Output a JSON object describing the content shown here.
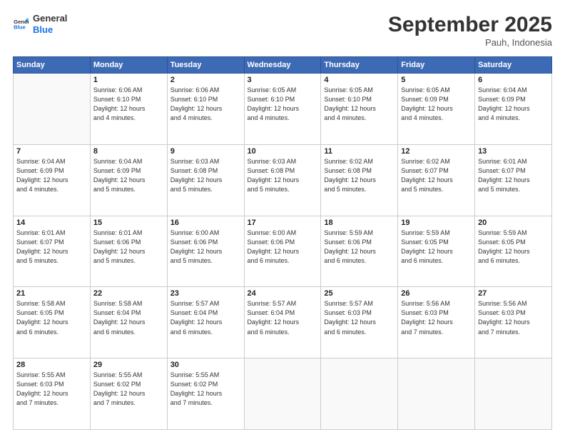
{
  "header": {
    "logo_line1": "General",
    "logo_line2": "Blue",
    "month_title": "September 2025",
    "location": "Pauh, Indonesia"
  },
  "weekdays": [
    "Sunday",
    "Monday",
    "Tuesday",
    "Wednesday",
    "Thursday",
    "Friday",
    "Saturday"
  ],
  "weeks": [
    [
      {
        "day": "",
        "info": ""
      },
      {
        "day": "1",
        "info": "Sunrise: 6:06 AM\nSunset: 6:10 PM\nDaylight: 12 hours\nand 4 minutes."
      },
      {
        "day": "2",
        "info": "Sunrise: 6:06 AM\nSunset: 6:10 PM\nDaylight: 12 hours\nand 4 minutes."
      },
      {
        "day": "3",
        "info": "Sunrise: 6:05 AM\nSunset: 6:10 PM\nDaylight: 12 hours\nand 4 minutes."
      },
      {
        "day": "4",
        "info": "Sunrise: 6:05 AM\nSunset: 6:10 PM\nDaylight: 12 hours\nand 4 minutes."
      },
      {
        "day": "5",
        "info": "Sunrise: 6:05 AM\nSunset: 6:09 PM\nDaylight: 12 hours\nand 4 minutes."
      },
      {
        "day": "6",
        "info": "Sunrise: 6:04 AM\nSunset: 6:09 PM\nDaylight: 12 hours\nand 4 minutes."
      }
    ],
    [
      {
        "day": "7",
        "info": "Sunrise: 6:04 AM\nSunset: 6:09 PM\nDaylight: 12 hours\nand 4 minutes."
      },
      {
        "day": "8",
        "info": "Sunrise: 6:04 AM\nSunset: 6:09 PM\nDaylight: 12 hours\nand 5 minutes."
      },
      {
        "day": "9",
        "info": "Sunrise: 6:03 AM\nSunset: 6:08 PM\nDaylight: 12 hours\nand 5 minutes."
      },
      {
        "day": "10",
        "info": "Sunrise: 6:03 AM\nSunset: 6:08 PM\nDaylight: 12 hours\nand 5 minutes."
      },
      {
        "day": "11",
        "info": "Sunrise: 6:02 AM\nSunset: 6:08 PM\nDaylight: 12 hours\nand 5 minutes."
      },
      {
        "day": "12",
        "info": "Sunrise: 6:02 AM\nSunset: 6:07 PM\nDaylight: 12 hours\nand 5 minutes."
      },
      {
        "day": "13",
        "info": "Sunrise: 6:01 AM\nSunset: 6:07 PM\nDaylight: 12 hours\nand 5 minutes."
      }
    ],
    [
      {
        "day": "14",
        "info": "Sunrise: 6:01 AM\nSunset: 6:07 PM\nDaylight: 12 hours\nand 5 minutes."
      },
      {
        "day": "15",
        "info": "Sunrise: 6:01 AM\nSunset: 6:06 PM\nDaylight: 12 hours\nand 5 minutes."
      },
      {
        "day": "16",
        "info": "Sunrise: 6:00 AM\nSunset: 6:06 PM\nDaylight: 12 hours\nand 5 minutes."
      },
      {
        "day": "17",
        "info": "Sunrise: 6:00 AM\nSunset: 6:06 PM\nDaylight: 12 hours\nand 6 minutes."
      },
      {
        "day": "18",
        "info": "Sunrise: 5:59 AM\nSunset: 6:06 PM\nDaylight: 12 hours\nand 6 minutes."
      },
      {
        "day": "19",
        "info": "Sunrise: 5:59 AM\nSunset: 6:05 PM\nDaylight: 12 hours\nand 6 minutes."
      },
      {
        "day": "20",
        "info": "Sunrise: 5:59 AM\nSunset: 6:05 PM\nDaylight: 12 hours\nand 6 minutes."
      }
    ],
    [
      {
        "day": "21",
        "info": "Sunrise: 5:58 AM\nSunset: 6:05 PM\nDaylight: 12 hours\nand 6 minutes."
      },
      {
        "day": "22",
        "info": "Sunrise: 5:58 AM\nSunset: 6:04 PM\nDaylight: 12 hours\nand 6 minutes."
      },
      {
        "day": "23",
        "info": "Sunrise: 5:57 AM\nSunset: 6:04 PM\nDaylight: 12 hours\nand 6 minutes."
      },
      {
        "day": "24",
        "info": "Sunrise: 5:57 AM\nSunset: 6:04 PM\nDaylight: 12 hours\nand 6 minutes."
      },
      {
        "day": "25",
        "info": "Sunrise: 5:57 AM\nSunset: 6:03 PM\nDaylight: 12 hours\nand 6 minutes."
      },
      {
        "day": "26",
        "info": "Sunrise: 5:56 AM\nSunset: 6:03 PM\nDaylight: 12 hours\nand 7 minutes."
      },
      {
        "day": "27",
        "info": "Sunrise: 5:56 AM\nSunset: 6:03 PM\nDaylight: 12 hours\nand 7 minutes."
      }
    ],
    [
      {
        "day": "28",
        "info": "Sunrise: 5:55 AM\nSunset: 6:03 PM\nDaylight: 12 hours\nand 7 minutes."
      },
      {
        "day": "29",
        "info": "Sunrise: 5:55 AM\nSunset: 6:02 PM\nDaylight: 12 hours\nand 7 minutes."
      },
      {
        "day": "30",
        "info": "Sunrise: 5:55 AM\nSunset: 6:02 PM\nDaylight: 12 hours\nand 7 minutes."
      },
      {
        "day": "",
        "info": ""
      },
      {
        "day": "",
        "info": ""
      },
      {
        "day": "",
        "info": ""
      },
      {
        "day": "",
        "info": ""
      }
    ]
  ]
}
